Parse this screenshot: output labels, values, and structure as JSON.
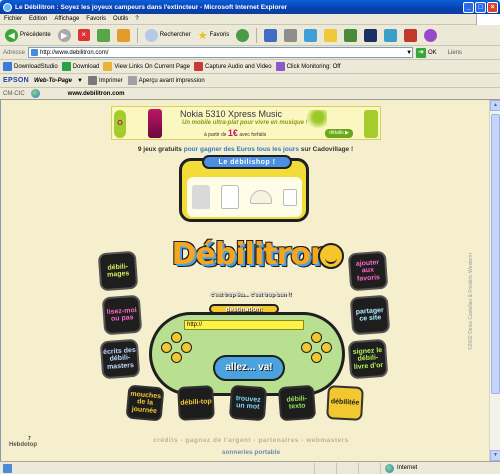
{
  "window": {
    "title": "Le Débilitron : Soyez les joyeux campeurs dans l'extincteur - Microsoft Internet Explorer",
    "buttons": [
      "_",
      "□",
      "×"
    ]
  },
  "menubar": {
    "items": [
      "Fichier",
      "Edition",
      "Affichage",
      "Favoris",
      "Outils",
      "?"
    ]
  },
  "toolbar": {
    "back_label": "Précédente",
    "search_label": "Rechercher",
    "favorites_label": "Favoris"
  },
  "addressbar": {
    "label": "Adresse",
    "url": "http://www.debilitron.com/",
    "go_label": "OK",
    "links_label": "Liens"
  },
  "linkbar": {
    "items": [
      "DownloadStudio",
      "Download",
      "View Links On Current Page",
      "Capture Audio and Video",
      "Click Monitoring: Off"
    ]
  },
  "epsonbar": {
    "brand": "EPSON",
    "web_to_page": "Web-To-Page",
    "print_label": "Imprimer",
    "preview_label": "Aperçu avant impression"
  },
  "cicbar": {
    "label": "CM-CIC",
    "site": "www.debilitron.com"
  },
  "page": {
    "banner": {
      "title": "Nokia 5310 Xpress Music",
      "subtitle": "Un mobile ultra-plat pour vivre en musique !",
      "price_prefix": "à partir de",
      "price": "1€",
      "price_suffix": "avec forfaits",
      "cta": "détails ▶",
      "side_left": "O"
    },
    "promo": {
      "prefix": "9 jeux gratuits",
      "highlight": "pour gagner des Euros tous les jours",
      "suffix": "sur Cadovillage !"
    },
    "shop_title": "Le débilishop !",
    "logo": "Débilitron",
    "tagline": "c'est trop lka... c'est trop bon !!",
    "destination_label": "destination:",
    "url_value": "http://",
    "go_button": "allez... va!",
    "side_buttons": {
      "b1": "débili-mages",
      "b2": "lisez-moi ou pas",
      "b3": "écrits des débili-masters",
      "b4": "ajouter aux favoris",
      "b5": "partager ce site",
      "b6": "signez le débili-livre d'or"
    },
    "bottom_buttons": {
      "bb1": "mouches de la journée",
      "bb2": "débili-top",
      "bb3": "trouvez un mot",
      "bb4": "débili-texto",
      "bb5": "débilitée"
    },
    "footer_links": "crédits - gagnez de l'argent - partenaires - webmasters",
    "footer_links2": "sonneries portable",
    "hebdotop_num": "7",
    "hebdotop": "Hebdotop",
    "copyright": "©2002 Denis Castellan & Frédéric Westerm"
  },
  "statusbar": {
    "zone": "Internet"
  }
}
